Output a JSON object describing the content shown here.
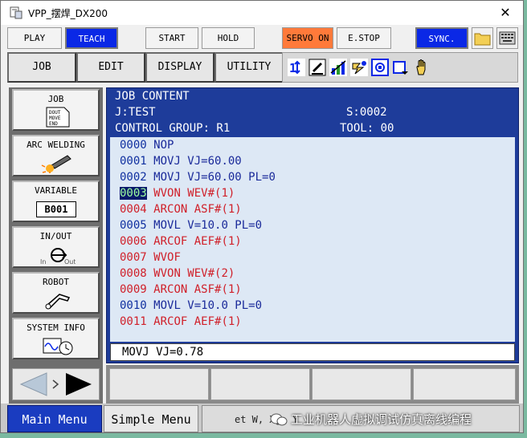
{
  "window": {
    "title": "VPP_摆焊_DX200",
    "close": "✕"
  },
  "toolbar": {
    "play": "PLAY",
    "teach": "TEACH",
    "start": "START",
    "hold": "HOLD",
    "servo_on": "SERVO ON",
    "estop": "E.STOP",
    "sync": "SYNC."
  },
  "menu": {
    "job": "JOB",
    "edit": "EDIT",
    "display": "DISPLAY",
    "utility": "UTILITY"
  },
  "left_menu": {
    "job": "JOB",
    "job_icon_text": [
      "DOUT",
      "MOVE",
      "END"
    ],
    "arc_welding": "ARC WELDING",
    "variable": "VARIABLE",
    "variable_value": "B001",
    "inout": "IN/OUT",
    "inout_in": "In",
    "inout_out": "Out",
    "robot": "ROBOT",
    "system_info": "SYSTEM INFO"
  },
  "job_content": {
    "title": "JOB CONTENT",
    "job_name": "J:TEST",
    "step": "S:0002",
    "control_group": "CONTROL GROUP: R1",
    "tool": "TOOL: 00",
    "lines": [
      {
        "no": "0000",
        "cmd": "NOP",
        "color": "blue"
      },
      {
        "no": "0001",
        "cmd": "MOVJ VJ=60.00",
        "color": "blue"
      },
      {
        "no": "0002",
        "cmd": "MOVJ VJ=60.00 PL=0",
        "color": "blue"
      },
      {
        "no": "0003",
        "cmd": "WVON WEV#(1)",
        "color": "red"
      },
      {
        "no": "0004",
        "cmd": "ARCON ASF#(1)",
        "color": "red"
      },
      {
        "no": "0005",
        "cmd": "MOVL V=10.0 PL=0",
        "color": "blue"
      },
      {
        "no": "0006",
        "cmd": "ARCOF AEF#(1)",
        "color": "red"
      },
      {
        "no": "0007",
        "cmd": "WVOF",
        "color": "red"
      },
      {
        "no": "0008",
        "cmd": "WVON WEV#(2)",
        "color": "red"
      },
      {
        "no": "0009",
        "cmd": "ARCON ASF#(1)",
        "color": "red"
      },
      {
        "no": "0010",
        "cmd": "MOVL V=10.0 PL=0",
        "color": "blue"
      },
      {
        "no": "0011",
        "cmd": "ARCOF AEF#(1)",
        "color": "red"
      }
    ],
    "edit_line": "MOVJ VJ=0.78"
  },
  "footer": {
    "main_menu": "Main Menu",
    "simple_menu": "Simple Menu",
    "message_fragment": "et W, Xg, Y",
    "watermark": "工业机器人虚拟调试仿真离线编程"
  },
  "colors": {
    "blue_button": "#0a28e6",
    "servo_on": "#ff7a3a",
    "header_bg": "#1e3c9a",
    "list_bg": "#dde8f5",
    "cmd_red": "#d0202a",
    "cmd_blue": "#1a2a9a",
    "cursor_text": "#9fff9f"
  }
}
